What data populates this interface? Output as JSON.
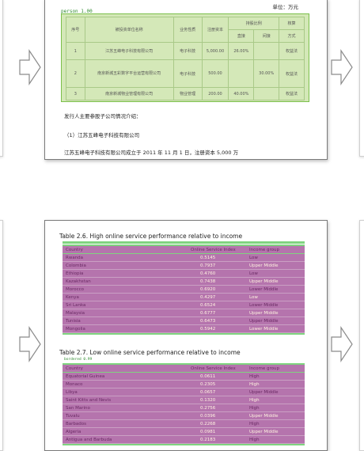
{
  "top_page": {
    "unit_label": "单位：万元",
    "detection_label": "person 1.00",
    "table": {
      "header_top": [
        "序号",
        "被投资单位名称",
        "业务性质",
        "注册资本",
        "持股比例",
        "核算"
      ],
      "header_sub": [
        "直接",
        "间接",
        "方式"
      ],
      "rows": [
        [
          "1",
          "江苏五峰电子科技有限公司",
          "电子科技",
          "5,000.00",
          "26.00%",
          "",
          "权益法"
        ],
        [
          "2",
          "南京新城五彩数字平台运营有限公司",
          "电子科技",
          "500.00",
          "",
          "30.00%",
          "权益法"
        ],
        [
          "3",
          "南京新城物业管理有限公司",
          "物业管理",
          "200.00",
          "40.00%",
          "",
          "权益法"
        ]
      ]
    },
    "paragraphs": [
      "发行人主要参股子公司情况介绍：",
      "（1）江苏五峰电子科技有限公司",
      "江苏五峰电子科技有限公司成立于 2011 年 11 月 1 日，注册资本 5,000 万"
    ]
  },
  "bottom_page": {
    "table1": {
      "caption": "Table 2.6.   High online service performance relative to income",
      "header": [
        "Country",
        "Online Service Index",
        "Income group"
      ],
      "rows": [
        [
          "Rwanda",
          "0.5145",
          "Low"
        ],
        [
          "Colombia",
          "0.7937",
          "Upper Middle"
        ],
        [
          "Ethiopia",
          "0.4760",
          "Low"
        ],
        [
          "Kazakhstan",
          "0.7438",
          "Upper Middle"
        ],
        [
          "Morocco",
          "0.6920",
          "Lower Middle"
        ],
        [
          "Kenya",
          "0.4297",
          "Low"
        ],
        [
          "Sri Lanka",
          "0.6524",
          "Lower Middle"
        ],
        [
          "Malaysia",
          "0.6777",
          "Upper Middle"
        ],
        [
          "Tunisia",
          "0.6473",
          "Upper Middle"
        ],
        [
          "Mongolia",
          "0.5942",
          "Lower Middle"
        ]
      ]
    },
    "table2": {
      "caption": "Table 2.7.   Low online service performance relative to income",
      "detection_label": "bordered 0.99",
      "header": [
        "Country",
        "Online Service Index",
        "Income group"
      ],
      "rows": [
        [
          "Equatorial Guinea",
          "0.0611",
          "High"
        ],
        [
          "Monaco",
          "0.2305",
          "High"
        ],
        [
          "Libya",
          "0.0657",
          "Upper Middle"
        ],
        [
          "Saint Kitts and Nevis",
          "0.1320",
          "High"
        ],
        [
          "San Marino",
          "0.2756",
          "High"
        ],
        [
          "Tuvalu",
          "0.0396",
          "Upper Middle"
        ],
        [
          "Barbados",
          "0.2268",
          "High"
        ],
        [
          "Algeria",
          "0.0981",
          "Upper Middle"
        ],
        [
          "Antigua and Barbuda",
          "0.2183",
          "High"
        ]
      ]
    }
  },
  "colors": {
    "table_highlight_green": "#d4e8b8",
    "table_highlight_magenta": "#b574ad",
    "detection_green": "#7fd47f"
  },
  "icons": [
    "arrow-right-icon"
  ]
}
